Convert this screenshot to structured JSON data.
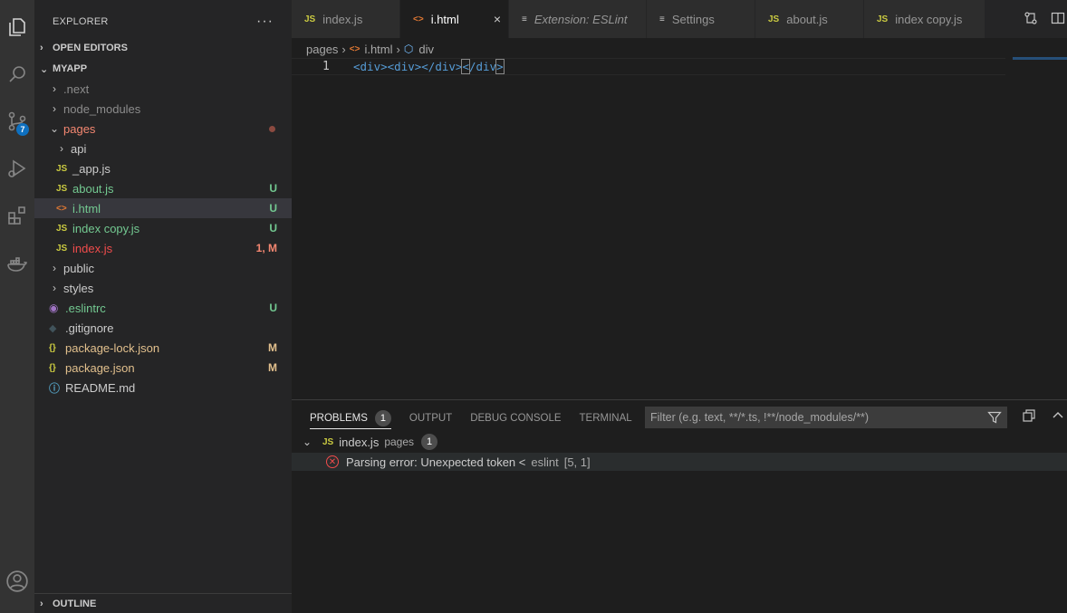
{
  "activity_bar": {
    "scm_badge": "7"
  },
  "sidebar": {
    "title": "EXPLORER",
    "more": "···",
    "open_editors": "OPEN EDITORS",
    "project": "MYAPP",
    "outline": "OUTLINE",
    "tree": [
      {
        "label": ".next",
        "status": ""
      },
      {
        "label": "node_modules",
        "status": ""
      },
      {
        "label": "pages",
        "status": ""
      },
      {
        "label": "api",
        "status": ""
      },
      {
        "label": "_app.js",
        "status": ""
      },
      {
        "label": "about.js",
        "status": "U"
      },
      {
        "label": "i.html",
        "status": "U"
      },
      {
        "label": "index copy.js",
        "status": "U"
      },
      {
        "label": "index.js",
        "status": "1, M"
      },
      {
        "label": "public",
        "status": ""
      },
      {
        "label": "styles",
        "status": ""
      },
      {
        "label": ".eslintrc",
        "status": "U"
      },
      {
        "label": ".gitignore",
        "status": ""
      },
      {
        "label": "package-lock.json",
        "status": "M"
      },
      {
        "label": "package.json",
        "status": "M"
      },
      {
        "label": "README.md",
        "status": ""
      }
    ]
  },
  "icons": {
    "js": "JS",
    "html": "<>",
    "json": "{}"
  },
  "tabs": [
    {
      "label": "index.js"
    },
    {
      "label": "i.html",
      "close": "×"
    },
    {
      "label": "Extension: ESLint"
    },
    {
      "label": "Settings"
    },
    {
      "label": "about.js"
    },
    {
      "label": "index copy.js"
    }
  ],
  "breadcrumb": {
    "folder": "pages",
    "file": "i.html",
    "symbol": "div"
  },
  "editor": {
    "line_number": "1",
    "code": {
      "t1": "<div>",
      "t2": "<div>",
      "t3": "</div>",
      "t4": "<",
      "t5": "/div",
      "t6": ">"
    }
  },
  "panel": {
    "tabs": {
      "problems": "PROBLEMS",
      "problems_count": "1",
      "output": "OUTPUT",
      "debug": "DEBUG CONSOLE",
      "terminal": "TERMINAL"
    },
    "filter_placeholder": "Filter (e.g. text, **/*.ts, !**/node_modules/**)",
    "problem_file": {
      "name": "index.js",
      "path": "pages",
      "count": "1"
    },
    "problem": {
      "message": "Parsing error: Unexpected token <",
      "source": "eslint",
      "location": "[5, 1]"
    }
  }
}
